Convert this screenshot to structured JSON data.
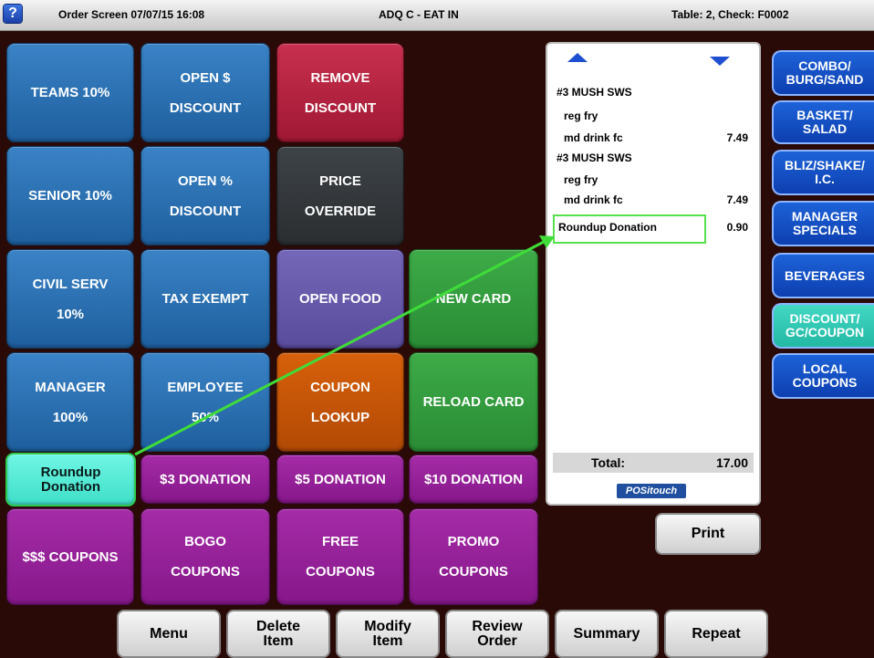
{
  "titlebar": {
    "help_label": "?",
    "screen": "Order Screen 07/07/15 16:08",
    "mode": "ADQ C - EAT IN",
    "table": "Table:  2, Check: F0002"
  },
  "buttons": {
    "teams": [
      "TEAMS 10%"
    ],
    "open_dollar": [
      "OPEN $",
      "DISCOUNT"
    ],
    "remove": [
      "REMOVE",
      "DISCOUNT"
    ],
    "senior": [
      "SENIOR 10%"
    ],
    "open_pct": [
      "OPEN %",
      "DISCOUNT"
    ],
    "price_override": [
      "PRICE",
      "OVERRIDE"
    ],
    "civil": [
      "CIVIL SERV",
      "10%"
    ],
    "tax_exempt": [
      "TAX EXEMPT"
    ],
    "open_food": [
      "OPEN FOOD"
    ],
    "new_card": [
      "NEW CARD"
    ],
    "manager": [
      "MANAGER",
      "100%"
    ],
    "employee": [
      "EMPLOYEE",
      "50%"
    ],
    "coupon_lookup": [
      "COUPON",
      "LOOKUP"
    ],
    "reload_card": [
      "RELOAD CARD"
    ],
    "roundup": [
      "Roundup",
      "Donation"
    ],
    "don3": [
      "$3 DONATION"
    ],
    "don5": [
      "$5 DONATION"
    ],
    "don10": [
      "$10 DONATION"
    ],
    "coupons": [
      "$$$ COUPONS"
    ],
    "bogo": [
      "BOGO",
      "COUPONS"
    ],
    "free": [
      "FREE",
      "COUPONS"
    ],
    "promo": [
      "PROMO",
      "COUPONS"
    ]
  },
  "receipt": {
    "items": [
      {
        "name": "#3 MUSH SWS",
        "price": ""
      },
      {
        "name": "reg fry",
        "price": ""
      },
      {
        "name": "md drink fc",
        "price": "7.49"
      },
      {
        "name": "#3 MUSH SWS",
        "price": ""
      },
      {
        "name": "reg fry",
        "price": ""
      },
      {
        "name": "md drink fc",
        "price": "7.49"
      },
      {
        "name": "Roundup Donation",
        "price": "0.90"
      }
    ],
    "total_label": "Total:",
    "total_value": "17.00",
    "brand": "POSitouch"
  },
  "categories": [
    [
      "COMBO/",
      "BURG/SAND"
    ],
    [
      "BASKET/",
      "SALAD"
    ],
    [
      "BLIZ/SHAKE/",
      "I.C."
    ],
    [
      "MANAGER",
      "SPECIALS"
    ],
    [
      "BEVERAGES"
    ],
    [
      "DISCOUNT/",
      "GC/COUPON"
    ],
    [
      "LOCAL",
      "COUPONS"
    ]
  ],
  "print_label": "Print",
  "bottom": [
    [
      "Menu"
    ],
    [
      "Delete",
      "Item"
    ],
    [
      "Modify",
      "Item"
    ],
    [
      "Review",
      "Order"
    ],
    [
      "Summary"
    ],
    [
      "Repeat"
    ]
  ],
  "colors": {
    "highlight": "#2cc94e",
    "arrow": "#3fdc3a"
  }
}
